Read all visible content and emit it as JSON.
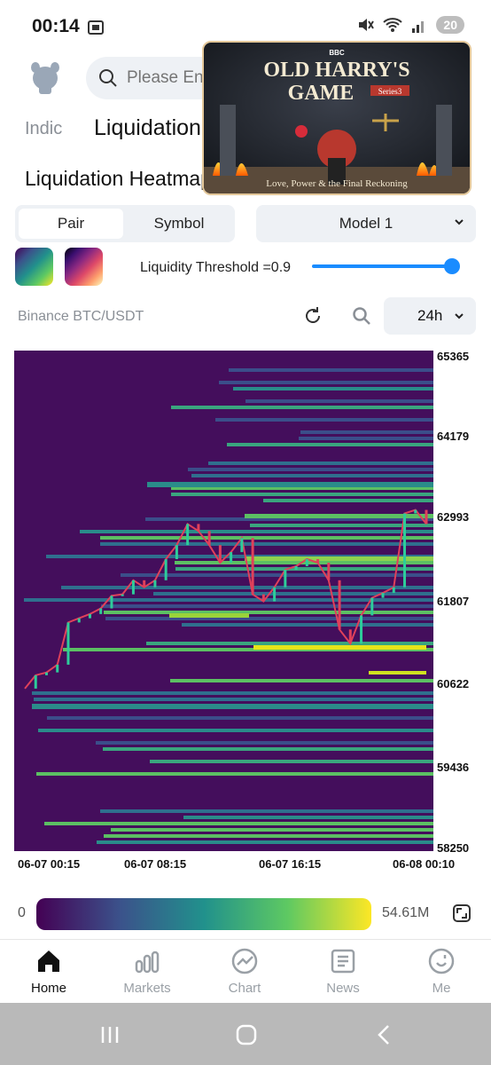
{
  "status_bar": {
    "time": "00:14",
    "battery": "20",
    "icons": [
      "screenshot-icon",
      "mute-icon",
      "wifi-icon",
      "signal-icon"
    ]
  },
  "header": {
    "search_placeholder": "Please Enter"
  },
  "tabs": {
    "indicator": "Indic",
    "liquidation": "Liquidation"
  },
  "section_title": "Liquidation Heatmap",
  "pip": {
    "title_line1": "OLD HARRY'S",
    "title_line2": "GAME",
    "series": "Series3",
    "network": "BBC",
    "tagline": "Love, Power & the Final Reckoning"
  },
  "controls": {
    "pair_label": "Pair",
    "symbol_label": "Symbol",
    "model": "Model 1",
    "threshold_label": "Liquidity Threshold =0.9",
    "threshold_value": 0.9,
    "exchange_pair": "Binance BTC/USDT",
    "range": "24h"
  },
  "chart_data": {
    "type": "heatmap",
    "y_ticks": [
      "65365",
      "64179",
      "62993",
      "61807",
      "60622",
      "59436",
      "58250"
    ],
    "x_ticks": [
      "06-07 00:15",
      "06-07 08:15",
      "06-07 16:15",
      "06-08 00:10"
    ],
    "ylim": [
      58250,
      65365
    ],
    "colorscale_min": "0",
    "colorscale_max": "54.61M",
    "price_series": [
      60560,
      60750,
      60790,
      60900,
      61500,
      61560,
      61620,
      61700,
      61880,
      61900,
      62100,
      62000,
      62100,
      62400,
      62600,
      62900,
      62800,
      62600,
      62350,
      62500,
      62700,
      61900,
      61800,
      62000,
      62250,
      62300,
      62400,
      62350,
      62100,
      61400,
      61200,
      61600,
      61850,
      61920,
      62000,
      63050,
      63100,
      62900
    ]
  },
  "legend": {
    "min": "0",
    "max": "54.61M"
  },
  "nav": [
    {
      "label": "Home",
      "icon": "home-icon"
    },
    {
      "label": "Markets",
      "icon": "markets-icon"
    },
    {
      "label": "Chart",
      "icon": "chart-icon"
    },
    {
      "label": "News",
      "icon": "news-icon"
    },
    {
      "label": "Me",
      "icon": "me-icon"
    }
  ]
}
